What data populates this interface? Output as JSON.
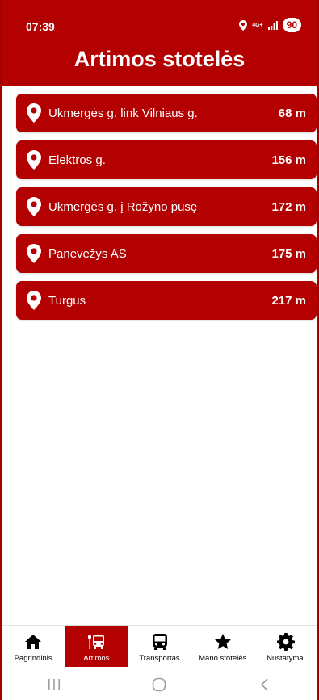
{
  "status_bar": {
    "time": "07:39",
    "network_label": "4G+",
    "battery": "90",
    "icons": [
      "location-icon",
      "signal-icon"
    ]
  },
  "header": {
    "title": "Artimos stotelės"
  },
  "stops": [
    {
      "name": "Ukmergės g. link Vilniaus g.",
      "distance": "68 m",
      "icon": "location-pin-icon"
    },
    {
      "name": "Elektros g.",
      "distance": "156 m",
      "icon": "location-pin-icon"
    },
    {
      "name": "Ukmergės g. į Rožyno pusę",
      "distance": "172 m",
      "icon": "location-pin-icon"
    },
    {
      "name": "Panevėžys AS",
      "distance": "175 m",
      "icon": "location-pin-icon"
    },
    {
      "name": "Turgus",
      "distance": "217 m",
      "icon": "location-pin-icon"
    }
  ],
  "bottom_nav": {
    "items": [
      {
        "label": "Pagrindinis",
        "icon": "home-icon",
        "active": false
      },
      {
        "label": "Artimos",
        "icon": "nearby-bus-stop-icon",
        "active": true
      },
      {
        "label": "Transportas",
        "icon": "bus-icon",
        "active": false
      },
      {
        "label": "Mano stotelės",
        "icon": "star-icon",
        "active": false
      },
      {
        "label": "Nustatymai",
        "icon": "gear-icon",
        "active": false
      }
    ]
  },
  "system_nav": {
    "icons": [
      "recent-apps-icon",
      "home-circle-icon",
      "back-icon"
    ]
  },
  "colors": {
    "primary": "#b30000",
    "on_primary": "#ffffff",
    "background": "#ffffff"
  }
}
